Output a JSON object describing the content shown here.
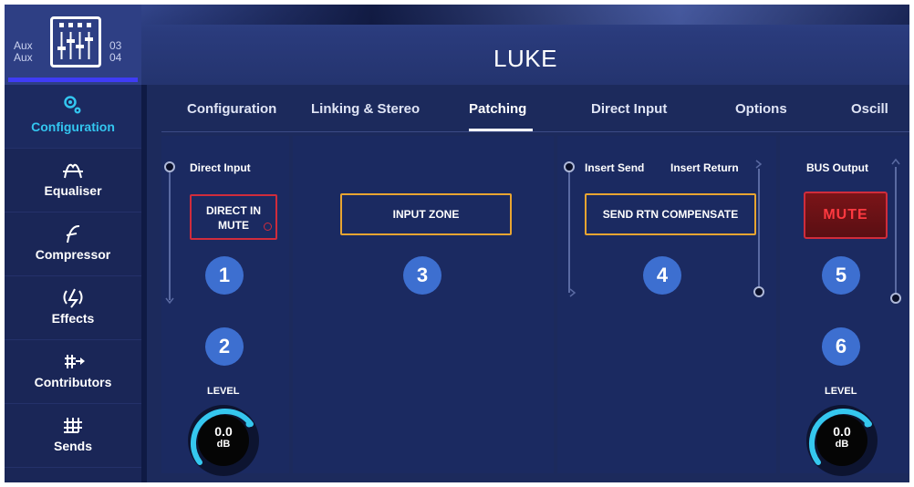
{
  "header": {
    "aux_top": "Aux",
    "aux_bottom": "Aux",
    "num_top": "03",
    "num_bottom": "04",
    "channel_name": "LUKE"
  },
  "sidebar": {
    "items": [
      {
        "label": "Configuration",
        "icon": "gear-icon",
        "active": true
      },
      {
        "label": "Equaliser",
        "icon": "equaliser-icon"
      },
      {
        "label": "Compressor",
        "icon": "compressor-icon"
      },
      {
        "label": "Effects",
        "icon": "effects-icon"
      },
      {
        "label": "Contributors",
        "icon": "contributors-icon"
      },
      {
        "label": "Sends",
        "icon": "sends-icon"
      }
    ]
  },
  "tabs": [
    {
      "label": "Configuration"
    },
    {
      "label": "Linking & Stereo"
    },
    {
      "label": "Patching",
      "active": true
    },
    {
      "label": "Direct Input"
    },
    {
      "label": "Options"
    },
    {
      "label": "Oscill"
    }
  ],
  "patching": {
    "direct_input_label": "Direct Input",
    "direct_in_mute_line1": "DIRECT IN",
    "direct_in_mute_line2": "MUTE",
    "input_zone": "INPUT ZONE",
    "insert_send_label": "Insert Send",
    "insert_return_label": "Insert Return",
    "send_rtn_compensate": "SEND RTN COMPENSATE",
    "bus_output_label": "BUS Output",
    "mute_label": "MUTE",
    "badges": [
      "1",
      "2",
      "3",
      "4",
      "5",
      "6"
    ],
    "left_level": {
      "label": "LEVEL",
      "value": "0.0",
      "unit": "dB"
    },
    "right_level": {
      "label": "LEVEL",
      "value": "0.0",
      "unit": "dB"
    }
  },
  "colors": {
    "background": "#1c2a5c",
    "accent": "#33c6f0",
    "badge": "#3d6fd0",
    "mute_red": "#d02c3c",
    "zone_orange": "#e8a531",
    "tab_indicator": "#3f3cf5"
  }
}
